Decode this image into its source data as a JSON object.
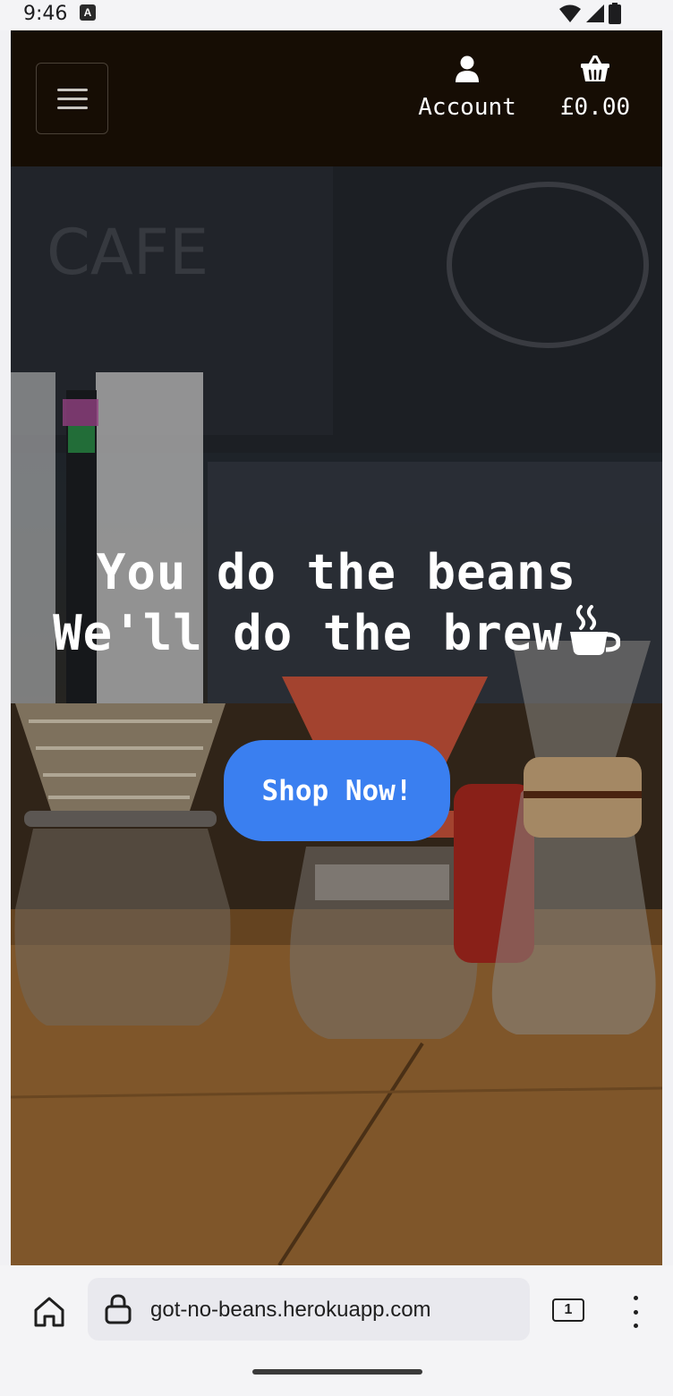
{
  "status_bar": {
    "time": "9:46",
    "notification_glyph": "A"
  },
  "header": {
    "menu_icon": "hamburger-icon",
    "account": {
      "icon": "user-icon",
      "label": "Account"
    },
    "basket": {
      "icon": "basket-icon",
      "label": "£0.00"
    }
  },
  "hero": {
    "title_line1": "You do the beans",
    "title_line2": "We'll do the brew",
    "title_icon": "hot-cup-icon",
    "cta_label": "Shop Now!",
    "cta_color": "#3a7ff0"
  },
  "browser": {
    "url": "got-no-beans.herokuapp.com",
    "tab_count": "1"
  }
}
